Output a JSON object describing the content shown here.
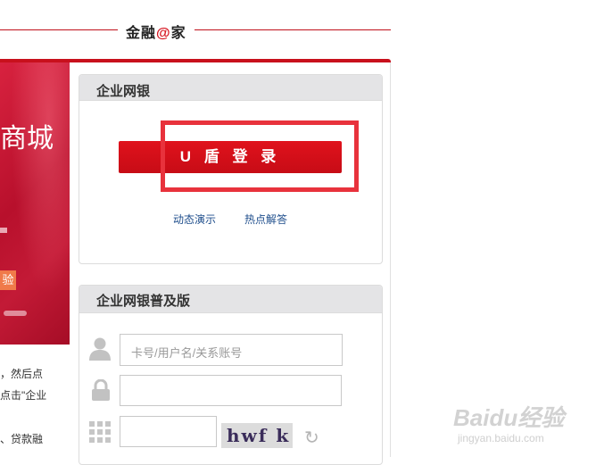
{
  "header": {
    "brand_pre": "金融",
    "brand_at": "@",
    "brand_post": "家"
  },
  "promo": {
    "title": "商城",
    "button": "验"
  },
  "side_texts": [
    "，然后点",
    "点击\"企业",
    "、贷款融"
  ],
  "enterprise_bank": {
    "title": "企业网银",
    "ukey_login_label": "U 盾 登 录",
    "link_demo": "动态演示",
    "link_faq": "热点解答"
  },
  "enterprise_lite": {
    "title": "企业网银普及版",
    "username_placeholder": "卡号/用户名/关系账号",
    "password_value": "",
    "captcha_value": "",
    "captcha_text": "hwf k"
  },
  "watermark": {
    "main": "Baidu经验",
    "sub": "jingyan.baidu.com"
  },
  "colors": {
    "accent": "#c8101c",
    "button": "#d30f19",
    "highlight": "#e8323c",
    "link": "#1f4e8c"
  },
  "icons": [
    "user-icon",
    "lock-icon",
    "keypad-icon",
    "refresh-icon"
  ]
}
